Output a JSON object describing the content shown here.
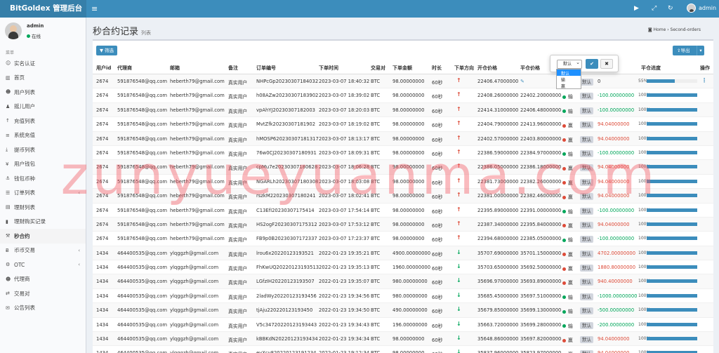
{
  "header": {
    "brand": "BitGoldex 管理后台",
    "user": "admin"
  },
  "sidebar": {
    "user": {
      "name": "admin",
      "status": "在线"
    },
    "section_label": "菜单",
    "items": [
      {
        "label": "实名认证",
        "icon": "id-card-icon",
        "glyph": "☺",
        "chevron": false
      },
      {
        "label": "首页",
        "icon": "chart-icon",
        "glyph": "▥",
        "chevron": false
      },
      {
        "label": "用户列表",
        "icon": "users-icon",
        "glyph": "☻",
        "chevron": false
      },
      {
        "label": "摇儿用户",
        "icon": "user-icon",
        "glyph": "♟",
        "chevron": false
      },
      {
        "label": "充值列表",
        "icon": "arrow-up-icon",
        "glyph": "↑",
        "chevron": false
      },
      {
        "label": "系统充值",
        "icon": "list-icon",
        "glyph": "≡",
        "chevron": false
      },
      {
        "label": "提币列表",
        "icon": "download-icon",
        "glyph": "⤓",
        "chevron": false
      },
      {
        "label": "用户钱包",
        "icon": "yen-icon",
        "glyph": "¥",
        "chevron": false
      },
      {
        "label": "钱包币种",
        "icon": "anchor-icon",
        "glyph": "⚓",
        "chevron": false
      },
      {
        "label": "订单列表",
        "icon": "list-icon",
        "glyph": "☰",
        "chevron": true
      },
      {
        "label": "理财列表",
        "icon": "briefcase-icon",
        "glyph": "▤",
        "chevron": false
      },
      {
        "label": "理财购买记录",
        "icon": "bar-chart-icon",
        "glyph": "▮",
        "chevron": false
      },
      {
        "label": "秒合约",
        "icon": "gavel-icon",
        "glyph": "⚒",
        "chevron": false,
        "active": true
      },
      {
        "label": "币币交易",
        "icon": "bitcoin-icon",
        "glyph": "Ƀ",
        "chevron": true
      },
      {
        "label": "OTC",
        "icon": "settings-icon",
        "glyph": "⚙",
        "chevron": true
      },
      {
        "label": "代理商",
        "icon": "users-icon",
        "glyph": "☻",
        "chevron": false
      },
      {
        "label": "交易对",
        "icon": "exchange-icon",
        "glyph": "⇄",
        "chevron": false
      },
      {
        "label": "公告列表",
        "icon": "bullhorn-icon",
        "glyph": "✉",
        "chevron": false
      }
    ]
  },
  "page": {
    "title": "秒合约记录",
    "subtitle": "列表",
    "breadcrumb_home": "Home",
    "breadcrumb_current": "Second-orders"
  },
  "toolbar": {
    "filter_label": "筛选",
    "export_label": "导出"
  },
  "columns": [
    "用户id",
    "代理商",
    "邮箱",
    "备注",
    "订单编号",
    "下单时间",
    "交易对",
    "下单金额",
    "时长",
    "下单方向",
    "开仓价格",
    "平仓价格",
    "",
    "",
    "平仓进度",
    "操作"
  ],
  "popover": {
    "select_value": "默认",
    "options": [
      "默认",
      "输",
      "赢"
    ],
    "highlight": 0
  },
  "watermark": "zunyueyuanma.com",
  "rows": [
    {
      "uid": "2674",
      "agent": "591876548@qq.com",
      "email": "heberth79@gmail.com",
      "note": "真实用户",
      "order": "NHPcGp20230307184032",
      "time": "2023-03-07 18:40:32",
      "pair": "BTC",
      "amount": "98.00000000",
      "duration": "60秒",
      "dir": "up",
      "open": "22406.47000000",
      "close": "",
      "result": "",
      "setting": "默认",
      "profit": "0",
      "progress": "55%",
      "pval": 0.55
    },
    {
      "uid": "2674",
      "agent": "591876548@qq.com",
      "email": "heberth79@gmail.com",
      "note": "真实用户",
      "order": "h08AZw20230307183902",
      "time": "2023-03-07 18:39:02",
      "pair": "BTC",
      "amount": "98.00000000",
      "duration": "60秒",
      "dir": "up",
      "open": "22408.26000000",
      "close": "22402.20000000",
      "result": "输",
      "setting": "默认",
      "profit": "-100.00000000",
      "progress": "100%",
      "pval": 1
    },
    {
      "uid": "2674",
      "agent": "591876548@qq.com",
      "email": "heberth79@gmail.com",
      "note": "真实用户",
      "order": "vpAhYJ20230307182003",
      "time": "2023-03-07 18:20:03",
      "pair": "BTC",
      "amount": "98.00000000",
      "duration": "60秒",
      "dir": "up",
      "open": "22414.31000000",
      "close": "22406.48000000",
      "result": "输",
      "setting": "默认",
      "profit": "-100.00000000",
      "progress": "100%",
      "pval": 1
    },
    {
      "uid": "2674",
      "agent": "591876548@qq.com",
      "email": "heberth79@gmail.com",
      "note": "真实用户",
      "order": "MvtZfk20230307181902",
      "time": "2023-03-07 18:19:02",
      "pair": "BTC",
      "amount": "98.00000000",
      "duration": "60秒",
      "dir": "up",
      "open": "22404.79000000",
      "close": "22413.96000000",
      "result": "赢",
      "setting": "默认",
      "profit": "94.04000000",
      "progress": "100%",
      "pval": 1
    },
    {
      "uid": "2674",
      "agent": "591876548@qq.com",
      "email": "heberth79@gmail.com",
      "note": "真实用户",
      "order": "hMOSP620230307181317",
      "time": "2023-03-07 18:13:17",
      "pair": "BTC",
      "amount": "98.00000000",
      "duration": "60秒",
      "dir": "up",
      "open": "22402.57000000",
      "close": "22403.80000000",
      "result": "赢",
      "setting": "默认",
      "profit": "94.04000000",
      "progress": "100%",
      "pval": 1
    },
    {
      "uid": "2674",
      "agent": "591876548@qq.com",
      "email": "heberth79@gmail.com",
      "note": "真实用户",
      "order": "76w0CJ20230307180931",
      "time": "2023-03-07 18:09:31",
      "pair": "BTC",
      "amount": "98.00000000",
      "duration": "60秒",
      "dir": "up",
      "open": "22386.59000000",
      "close": "22384.97000000",
      "result": "输",
      "setting": "默认",
      "profit": "-100.00000000",
      "progress": "100%",
      "pval": 1
    },
    {
      "uid": "2674",
      "agent": "591876548@qq.com",
      "email": "heberth79@gmail.com",
      "note": "真实用户",
      "order": "cpMu7e20230307180628",
      "time": "2023-03-07 18:06:28",
      "pair": "BTC",
      "amount": "98.00000000",
      "duration": "60秒",
      "dir": "up",
      "open": "22386.05000000",
      "close": "22386.18000000",
      "result": "赢",
      "setting": "默认",
      "profit": "94.04000000",
      "progress": "100%",
      "pval": 1
    },
    {
      "uid": "2674",
      "agent": "591876548@qq.com",
      "email": "heberth79@gmail.com",
      "note": "真实用户",
      "order": "NGARLh20230307180308",
      "time": "2023-03-07 18:03:08",
      "pair": "BTC",
      "amount": "98.00000000",
      "duration": "60秒",
      "dir": "up",
      "open": "22381.73000000",
      "close": "22382.26000000",
      "result": "赢",
      "setting": "默认",
      "profit": "94.04000000",
      "progress": "100%",
      "pval": 1
    },
    {
      "uid": "2674",
      "agent": "591876548@qq.com",
      "email": "heberth79@gmail.com",
      "note": "真实用户",
      "order": "rszkM220230307180241",
      "time": "2023-03-07 18:02:41",
      "pair": "BTC",
      "amount": "98.00000000",
      "duration": "60秒",
      "dir": "up",
      "open": "22381.00000000",
      "close": "22382.46000000",
      "result": "赢",
      "setting": "默认",
      "profit": "94.04000000",
      "progress": "100%",
      "pval": 1
    },
    {
      "uid": "2674",
      "agent": "591876548@qq.com",
      "email": "heberth79@gmail.com",
      "note": "真实用户",
      "order": "C13EfI20230307175414",
      "time": "2023-03-07 17:54:14",
      "pair": "BTC",
      "amount": "98.00000000",
      "duration": "60秒",
      "dir": "up",
      "open": "22395.89000000",
      "close": "22391.00000000",
      "result": "输",
      "setting": "默认",
      "profit": "-100.00000000",
      "progress": "100%",
      "pval": 1
    },
    {
      "uid": "2674",
      "agent": "591876548@qq.com",
      "email": "heberth79@gmail.com",
      "note": "真实用户",
      "order": "HS2ogF20230307175312",
      "time": "2023-03-07 17:53:12",
      "pair": "BTC",
      "amount": "98.00000000",
      "duration": "60秒",
      "dir": "up",
      "open": "22387.34000000",
      "close": "22395.84000000",
      "result": "赢",
      "setting": "默认",
      "profit": "94.04000000",
      "progress": "100%",
      "pval": 1
    },
    {
      "uid": "2674",
      "agent": "591876548@qq.com",
      "email": "heberth79@gmail.com",
      "note": "真实用户",
      "order": "FB9p0B20230307172337",
      "time": "2023-03-07 17:23:37",
      "pair": "BTC",
      "amount": "98.00000000",
      "duration": "60秒",
      "dir": "up",
      "open": "22394.68000000",
      "close": "22385.05000000",
      "result": "输",
      "setting": "默认",
      "profit": "-100.00000000",
      "progress": "100%",
      "pval": 1
    },
    {
      "uid": "1434",
      "agent": "464400535@qq.com",
      "email": "ylqggzh@gmail.com",
      "note": "真实用户",
      "order": "lrou6x20220123193521",
      "time": "2022-01-23 19:35:21",
      "pair": "BTC",
      "amount": "4900.00000000",
      "duration": "60秒",
      "dir": "down",
      "open": "35707.69000000",
      "close": "35701.15000000",
      "result": "赢",
      "setting": "默认",
      "profit": "4702.00000000",
      "progress": "100%",
      "pval": 1
    },
    {
      "uid": "1434",
      "agent": "464400535@qq.com",
      "email": "ylqggzh@gmail.com",
      "note": "真实用户",
      "order": "FhKwUQ20220123193513",
      "time": "2022-01-23 19:35:13",
      "pair": "BTC",
      "amount": "1960.00000000",
      "duration": "60秒",
      "dir": "down",
      "open": "35703.65000000",
      "close": "35692.50000000",
      "result": "赢",
      "setting": "默认",
      "profit": "1880.80000000",
      "progress": "100%",
      "pval": 1
    },
    {
      "uid": "1434",
      "agent": "464400535@qq.com",
      "email": "ylqggzh@gmail.com",
      "note": "真实用户",
      "order": "LGfzIH20220123193507",
      "time": "2022-01-23 19:35:07",
      "pair": "BTC",
      "amount": "980.00000000",
      "duration": "60秒",
      "dir": "down",
      "open": "35696.97000000",
      "close": "35693.89000000",
      "result": "赢",
      "setting": "默认",
      "profit": "940.40000000",
      "progress": "100%",
      "pval": 1
    },
    {
      "uid": "1434",
      "agent": "464400535@qq.com",
      "email": "ylqggzh@gmail.com",
      "note": "真实用户",
      "order": "2ladWy20220123193456",
      "time": "2022-01-23 19:34:56",
      "pair": "BTC",
      "amount": "980.00000000",
      "duration": "60秒",
      "dir": "down",
      "open": "35685.45000000",
      "close": "35697.51000000",
      "result": "输",
      "setting": "默认",
      "profit": "-1000.00000000",
      "progress": "100%",
      "pval": 1
    },
    {
      "uid": "1434",
      "agent": "464400535@qq.com",
      "email": "ylqggzh@gmail.com",
      "note": "真实用户",
      "order": "tjAju220220123193450",
      "time": "2022-01-23 19:34:50",
      "pair": "BTC",
      "amount": "490.00000000",
      "duration": "60秒",
      "dir": "down",
      "open": "35679.85000000",
      "close": "35699.13000000",
      "result": "输",
      "setting": "默认",
      "profit": "-500.00000000",
      "progress": "100%",
      "pval": 1
    },
    {
      "uid": "1434",
      "agent": "464400535@qq.com",
      "email": "ylqggzh@gmail.com",
      "note": "真实用户",
      "order": "V5c34720220123193443",
      "time": "2022-01-23 19:34:43",
      "pair": "BTC",
      "amount": "196.00000000",
      "duration": "60秒",
      "dir": "down",
      "open": "35663.72000000",
      "close": "35699.28000000",
      "result": "输",
      "setting": "默认",
      "profit": "-200.00000000",
      "progress": "100%",
      "pval": 1
    },
    {
      "uid": "1434",
      "agent": "464400535@qq.com",
      "email": "ylqggzh@gmail.com",
      "note": "真实用户",
      "order": "kBBKdN20220123193434",
      "time": "2022-01-23 19:34:34",
      "pair": "BTC",
      "amount": "98.00000000",
      "duration": "60秒",
      "dir": "down",
      "open": "35648.86000000",
      "close": "35697.82000000",
      "result": "赢",
      "setting": "默认",
      "profit": "94.04000000",
      "progress": "100%",
      "pval": 1
    },
    {
      "uid": "1434",
      "agent": "464400535@qq.com",
      "email": "ylqggzh@gmail.com",
      "note": "真实用户",
      "order": "eyXcv820220123191234",
      "time": "2022-01-23 19:12:34",
      "pair": "BTC",
      "amount": "98.00000000",
      "duration": "60秒",
      "dir": "down",
      "open": "35837.96000000",
      "close": "35823.97000000",
      "result": "赢",
      "setting": "默认",
      "profit": "94.04000000",
      "progress": "100%",
      "pval": 1
    }
  ]
}
